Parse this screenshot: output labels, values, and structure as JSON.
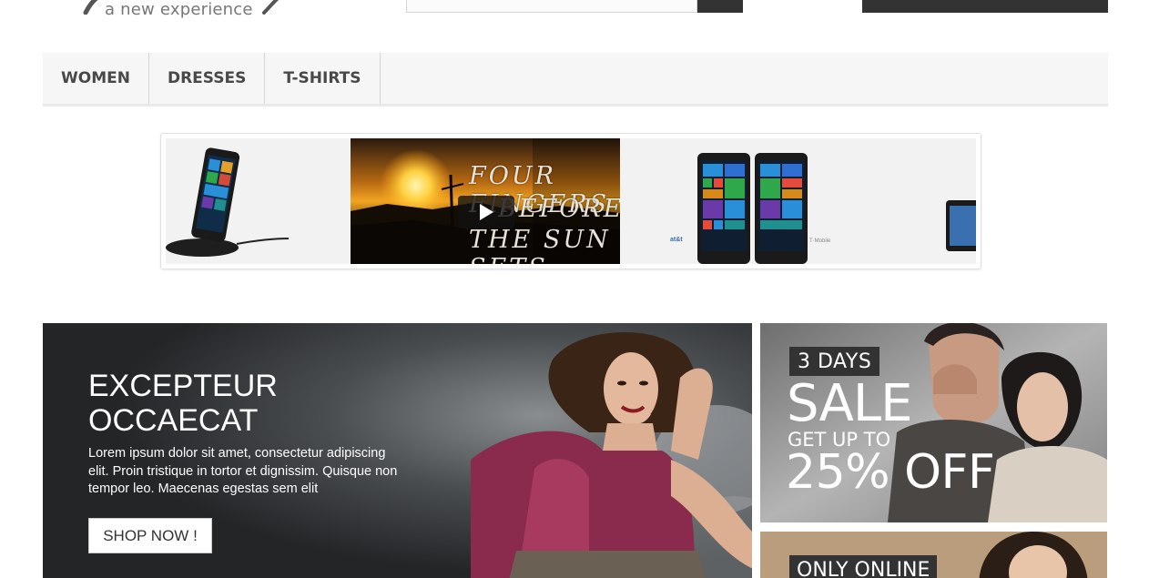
{
  "header": {
    "logo_tagline": "a new experience"
  },
  "menu": {
    "items": [
      {
        "label": "WOMEN"
      },
      {
        "label": "DRESSES"
      },
      {
        "label": "T-SHIRTS"
      }
    ]
  },
  "slider": {
    "video": {
      "title_lines": [
        "FOUR FINGERS",
        "BEFORE",
        "THE SUN SETS"
      ],
      "play_icon": "play-icon"
    },
    "carriers": {
      "att": "at&t",
      "tmobile": "T·Mobile"
    }
  },
  "hero": {
    "title_line1": "EXCEPTEUR",
    "title_line2": "OCCAECAT",
    "text": "Lorem ipsum dolor sit amet, consectetur adipiscing elit. Proin tristique in tortor et dignissim. Quisque non tempor leo. Maecenas egestas sem elit",
    "button_label": "SHOP NOW !"
  },
  "sale_banner": {
    "badge": "3 DAYS",
    "headline": "SALE",
    "subline": "GET UP TO",
    "discount": "25% OFF"
  },
  "online_banner": {
    "badge": "ONLY ONLINE"
  },
  "colors": {
    "dark": "#333333",
    "menu_bg": "#f6f6f6",
    "border": "#d6d4d4"
  }
}
